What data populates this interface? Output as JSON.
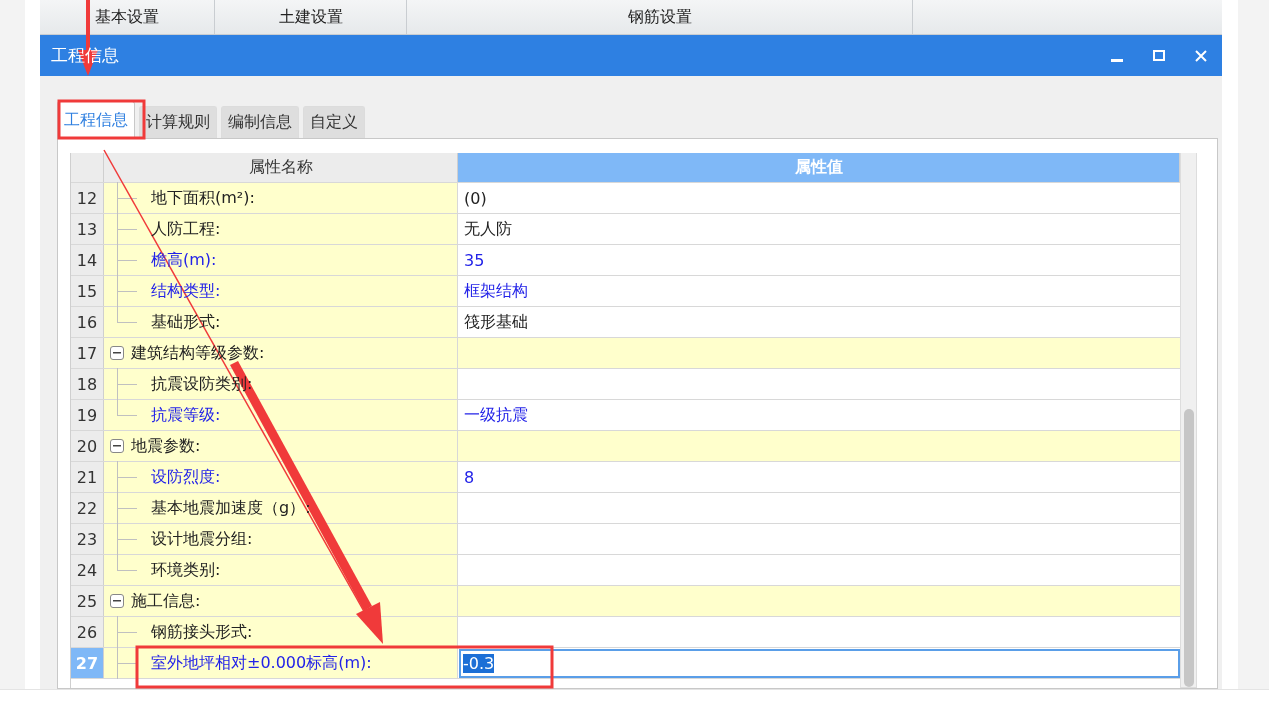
{
  "top_tabs": [
    {
      "label": "基本设置"
    },
    {
      "label": "土建设置"
    },
    {
      "label": "钢筋设置"
    }
  ],
  "window": {
    "title": "工程信息"
  },
  "tabs": [
    {
      "label": "工程信息",
      "selected": true
    },
    {
      "label": "计算规则",
      "selected": false
    },
    {
      "label": "编制信息",
      "selected": false
    },
    {
      "label": "自定义",
      "selected": false
    }
  ],
  "table": {
    "columns": [
      "属性名称",
      "属性值"
    ],
    "rows": [
      {
        "number": "12",
        "kind": "item",
        "label": "地下面积(m²):",
        "value": "(0)",
        "highlighted": false,
        "selected": false
      },
      {
        "number": "13",
        "kind": "item",
        "label": "人防工程:",
        "value": "无人防",
        "highlighted": false,
        "selected": false
      },
      {
        "number": "14",
        "kind": "item",
        "label": "檐高(m):",
        "value": "35",
        "highlighted": true,
        "selected": false
      },
      {
        "number": "15",
        "kind": "item",
        "label": "结构类型:",
        "value": "框架结构",
        "highlighted": true,
        "selected": false
      },
      {
        "number": "16",
        "kind": "item",
        "label": "基础形式:",
        "value": "筏形基础",
        "highlighted": false,
        "selected": false
      },
      {
        "number": "17",
        "kind": "group",
        "label": "建筑结构等级参数:",
        "expanded": true,
        "selected": false
      },
      {
        "number": "18",
        "kind": "item",
        "label": "抗震设防类别:",
        "highlighted": false,
        "selected": false
      },
      {
        "number": "19",
        "kind": "item",
        "label": "抗震等级:",
        "value": "一级抗震",
        "highlighted": true,
        "selected": false
      },
      {
        "number": "20",
        "kind": "group",
        "label": "地震参数:",
        "expanded": true,
        "selected": false
      },
      {
        "number": "21",
        "kind": "item",
        "label": "设防烈度:",
        "value": "8",
        "highlighted": true,
        "selected": false
      },
      {
        "number": "22",
        "kind": "item",
        "label": "基本地震加速度（g）:",
        "highlighted": false,
        "selected": false
      },
      {
        "number": "23",
        "kind": "item",
        "label": "设计地震分组:",
        "highlighted": false,
        "selected": false
      },
      {
        "number": "24",
        "kind": "item",
        "label": "环境类别:",
        "highlighted": false,
        "selected": false
      },
      {
        "number": "25",
        "kind": "group",
        "label": "施工信息:",
        "expanded": true,
        "selected": false
      },
      {
        "number": "26",
        "kind": "item",
        "label": "钢筋接头形式:",
        "highlighted": false,
        "selected": false
      },
      {
        "number": "27",
        "kind": "item",
        "label": "室外地坪相对±0.000标高(m):",
        "value": "-0.3",
        "highlighted": true,
        "selected": true
      }
    ]
  }
}
